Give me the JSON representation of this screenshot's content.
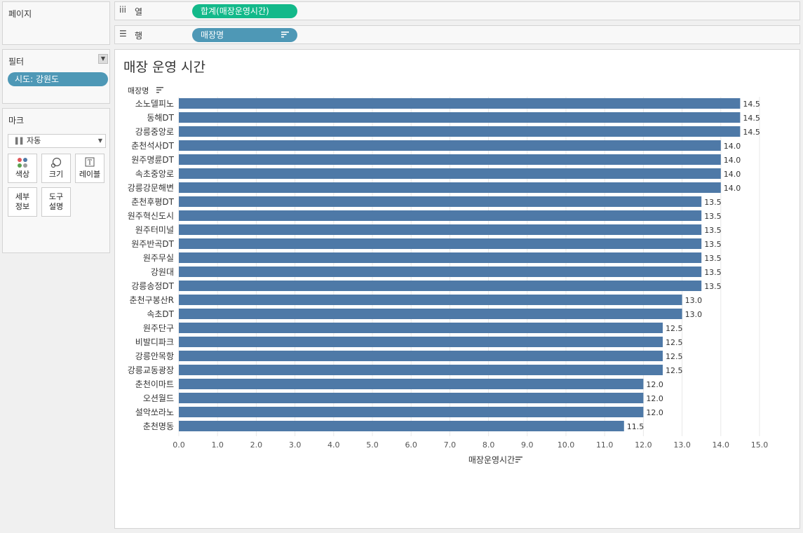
{
  "pages_panel": {
    "title": "페이지"
  },
  "filters_panel": {
    "title": "필터",
    "dropdown_icon": "caret-down-icon",
    "pill": "시도: 강원도"
  },
  "marks_panel": {
    "title": "마크",
    "mark_type": "자동",
    "buttons": [
      {
        "label": "색상",
        "icon": "color-dots-icon"
      },
      {
        "label": "크기",
        "icon": "size-icon"
      },
      {
        "label": "레이블",
        "icon": "label-icon"
      },
      {
        "label": "세부\n정보",
        "icon": ""
      },
      {
        "label": "도구\n설명",
        "icon": ""
      }
    ]
  },
  "columns_shelf": {
    "label": "열",
    "icon": "columns-icon",
    "pill": "합계(매장운영시간)"
  },
  "rows_shelf": {
    "label": "행",
    "icon": "rows-icon",
    "pill": "매장명"
  },
  "colors": {
    "bar": "#4e79a7",
    "pill_green": "#13b98a",
    "pill_blue": "#4e98b6",
    "gridline": "#e8e8e8"
  },
  "chart_data": {
    "type": "bar",
    "orientation": "horizontal",
    "title": "매장 운영 시간",
    "row_header": "매장명",
    "xlabel": "매장운영시간",
    "xlim": [
      0,
      15.5
    ],
    "x_ticks": [
      "0.0",
      "1.0",
      "2.0",
      "3.0",
      "4.0",
      "5.0",
      "6.0",
      "7.0",
      "8.0",
      "9.0",
      "10.0",
      "11.0",
      "12.0",
      "13.0",
      "14.0",
      "15.0"
    ],
    "grid": true,
    "categories": [
      "소노델피노",
      "동해DT",
      "강릉중앙로",
      "춘천석사DT",
      "원주명륜DT",
      "속초중앙로",
      "강릉강문해변",
      "춘천후평DT",
      "원주혁신도시",
      "원주터미널",
      "원주반곡DT",
      "원주무실",
      "강원대",
      "강릉송정DT",
      "춘천구봉산R",
      "속초DT",
      "원주단구",
      "비발디파크",
      "강릉안목항",
      "강릉교동광장",
      "춘천이마트",
      "오션월드",
      "설악쏘라노",
      "춘천명동"
    ],
    "values": [
      14.5,
      14.5,
      14.5,
      14.0,
      14.0,
      14.0,
      14.0,
      13.5,
      13.5,
      13.5,
      13.5,
      13.5,
      13.5,
      13.5,
      13.0,
      13.0,
      12.5,
      12.5,
      12.5,
      12.5,
      12.0,
      12.0,
      12.0,
      11.5
    ],
    "data_labels": [
      "14.5",
      "14.5",
      "14.5",
      "14.0",
      "14.0",
      "14.0",
      "14.0",
      "13.5",
      "13.5",
      "13.5",
      "13.5",
      "13.5",
      "13.5",
      "13.5",
      "13.0",
      "13.0",
      "12.5",
      "12.5",
      "12.5",
      "12.5",
      "12.0",
      "12.0",
      "12.0",
      "11.5"
    ]
  }
}
